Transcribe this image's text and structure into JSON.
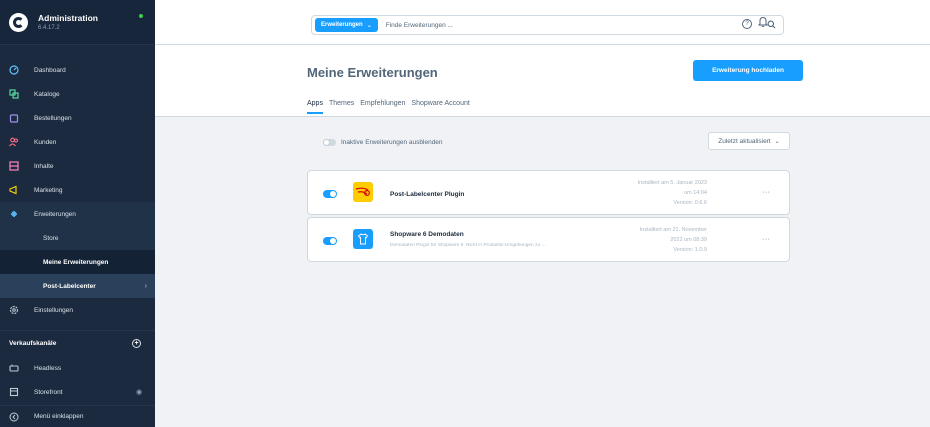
{
  "brand": {
    "title": "Administration",
    "version": "6.4.17.2"
  },
  "sidebar": {
    "items": [
      {
        "label": "Dashboard",
        "icon": "gauge-icon"
      },
      {
        "label": "Kataloge",
        "icon": "catalog-icon"
      },
      {
        "label": "Bestellungen",
        "icon": "bag-icon"
      },
      {
        "label": "Kunden",
        "icon": "users-icon"
      },
      {
        "label": "Inhalte",
        "icon": "content-icon"
      },
      {
        "label": "Marketing",
        "icon": "megaphone-icon"
      },
      {
        "label": "Erweiterungen",
        "icon": "plug-icon"
      }
    ],
    "sub_items": [
      {
        "label": "Store"
      },
      {
        "label": "Meine Erweiterungen"
      },
      {
        "label": "Post-Labelcenter"
      }
    ],
    "settings_label": "Einstellungen",
    "sales_channels": {
      "title": "Verkaufskanäle",
      "items": [
        {
          "label": "Headless"
        },
        {
          "label": "Storefront"
        }
      ]
    },
    "collapse_label": "Menü einklappen"
  },
  "topbar": {
    "search_type": "Erweiterungen",
    "search_placeholder": "Finde Erweiterungen ..."
  },
  "page": {
    "title": "Meine Erweiterungen",
    "upload_button": "Erweiterung hochladen",
    "tabs": [
      "Apps",
      "Themes",
      "Empfehlungen",
      "Shopware Account"
    ],
    "filter_label": "Inaktive Erweiterungen ausblenden",
    "sort_label": "Zuletzt aktualisiert"
  },
  "extensions": [
    {
      "name": "Post-Labelcenter Plugin",
      "description": "",
      "installed_line1": "Installiert am 5. Januar 2023",
      "installed_line2": "um 14:04",
      "version": "Version: 0.6.6"
    },
    {
      "name": "Shopware 6 Demodaten",
      "description": "Demodaten Plugin für Shopware 6. Nicht in Produktiv-Umgebungen zu …",
      "installed_line1": "Installiert am 21. November",
      "installed_line2": "2022 um 08:39",
      "version": "Version: 1.0.9"
    }
  ],
  "colors": {
    "sidebar_bg": "#1b2a3e",
    "accent": "#189eff",
    "text": "#52667a",
    "status_online": "#37d046",
    "post_yellow": "#ffcc00"
  }
}
